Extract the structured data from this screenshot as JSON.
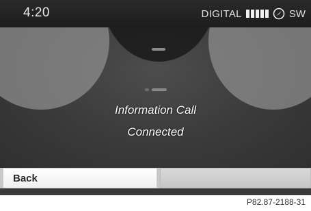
{
  "status_bar": {
    "time": "4:20",
    "reception_label": "DIGITAL",
    "signal_bars": 5,
    "compass_icon": "compass-icon",
    "heading": "SW"
  },
  "message": {
    "line1": "Information Call",
    "line2": "Connected"
  },
  "softkeys": {
    "back_label": "Back"
  },
  "footer": {
    "reference": "P82.87-2188-31"
  }
}
